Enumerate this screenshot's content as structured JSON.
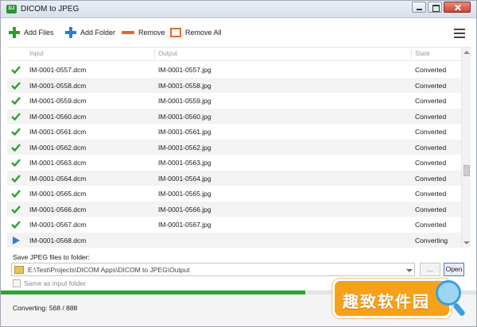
{
  "window": {
    "title": "DICOM to JPEG",
    "app_icon": "dicom-app-icon"
  },
  "toolbar": {
    "add_files": "Add Files",
    "add_folder": "Add Folder",
    "remove": "Remove",
    "remove_all": "Remove All",
    "icons": {
      "add_files": "plus-icon",
      "add_folder": "plus-icon",
      "remove": "minus-icon",
      "remove_all": "square-outline-icon",
      "menu": "hamburger-menu-icon"
    }
  },
  "table": {
    "columns": [
      "Input",
      "Output",
      "State"
    ],
    "rows": [
      {
        "status_icon": "checkmark-icon",
        "input": "IM-0001-0557.dcm",
        "output": "IM-0001-0557.jpg",
        "state": "Converted"
      },
      {
        "status_icon": "checkmark-icon",
        "input": "IM-0001-0558.dcm",
        "output": "IM-0001-0558.jpg",
        "state": "Converted"
      },
      {
        "status_icon": "checkmark-icon",
        "input": "IM-0001-0559.dcm",
        "output": "IM-0001-0559.jpg",
        "state": "Converted"
      },
      {
        "status_icon": "checkmark-icon",
        "input": "IM-0001-0560.dcm",
        "output": "IM-0001-0560.jpg",
        "state": "Converted"
      },
      {
        "status_icon": "checkmark-icon",
        "input": "IM-0001-0561.dcm",
        "output": "IM-0001-0561.jpg",
        "state": "Converted"
      },
      {
        "status_icon": "checkmark-icon",
        "input": "IM-0001-0562.dcm",
        "output": "IM-0001-0562.jpg",
        "state": "Converted"
      },
      {
        "status_icon": "checkmark-icon",
        "input": "IM-0001-0563.dcm",
        "output": "IM-0001-0563.jpg",
        "state": "Converted"
      },
      {
        "status_icon": "checkmark-icon",
        "input": "IM-0001-0564.dcm",
        "output": "IM-0001-0564.jpg",
        "state": "Converted"
      },
      {
        "status_icon": "checkmark-icon",
        "input": "IM-0001-0565.dcm",
        "output": "IM-0001-0565.jpg",
        "state": "Converted"
      },
      {
        "status_icon": "checkmark-icon",
        "input": "IM-0001-0566.dcm",
        "output": "IM-0001-0566.jpg",
        "state": "Converted"
      },
      {
        "status_icon": "checkmark-icon",
        "input": "IM-0001-0567.dcm",
        "output": "IM-0001-0567.jpg",
        "state": "Converted"
      },
      {
        "status_icon": "play-icon",
        "input": "IM-0001-0568.dcm",
        "output": "",
        "state": "Converting"
      }
    ]
  },
  "output": {
    "save_label": "Save JPEG files to folder:",
    "path": "E:\\Test\\Projects\\DICOM Apps\\DICOM to JPEG\\Output",
    "browse_label": "...",
    "open_label": "Open",
    "same_as_input_label": "Same as input folder",
    "same_as_input_checked": false
  },
  "progress": {
    "fraction": 0.64
  },
  "status": {
    "text": "Converting: 568 / 888"
  },
  "watermark": {
    "text": "趣致软件园",
    "icon": "magnifier-icon"
  },
  "colors": {
    "check_green": "#2ca02c",
    "play_blue": "#2a7fd4",
    "remove_orange": "#e06a2c",
    "progress_green": "#2ea52e"
  }
}
